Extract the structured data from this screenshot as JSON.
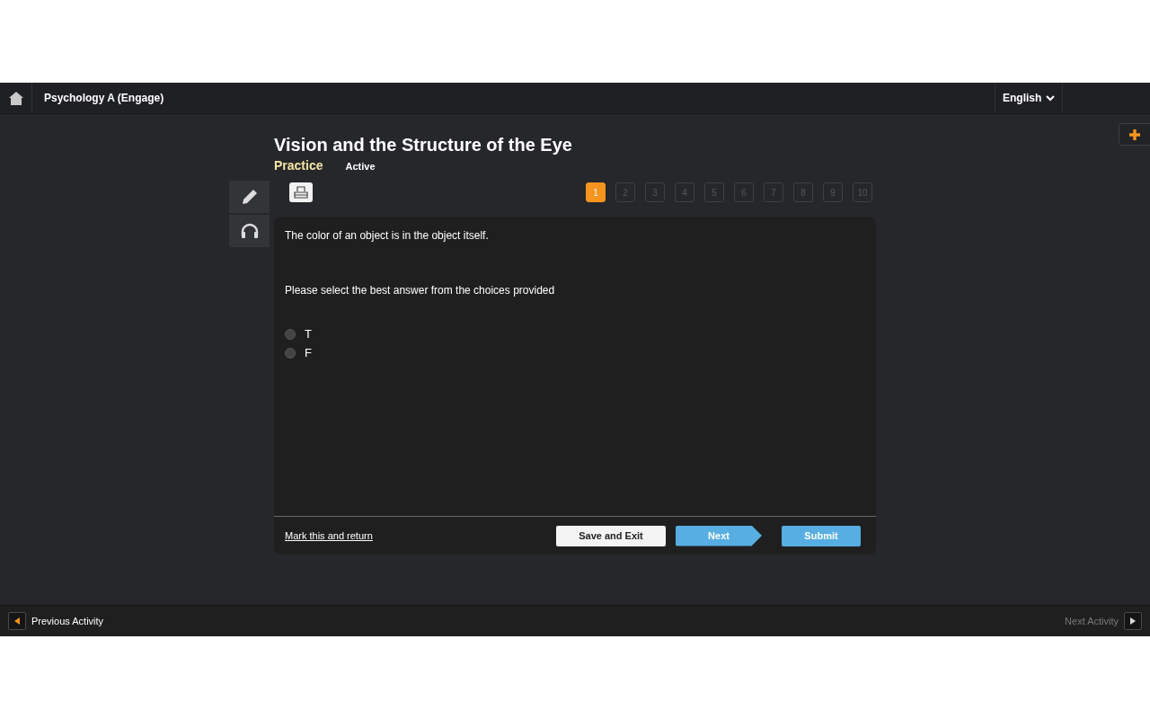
{
  "header": {
    "course": "Psychology A (Engage)",
    "language": "English"
  },
  "activity": {
    "title": "Vision and the Structure of the Eye",
    "type": "Practice",
    "status": "Active"
  },
  "pager": [
    {
      "label": "1",
      "selected": true
    },
    {
      "label": "2",
      "selected": false
    },
    {
      "label": "3",
      "selected": false
    },
    {
      "label": "4",
      "selected": false
    },
    {
      "label": "5",
      "selected": false
    },
    {
      "label": "6",
      "selected": false
    },
    {
      "label": "7",
      "selected": false
    },
    {
      "label": "8",
      "selected": false
    },
    {
      "label": "9",
      "selected": false
    },
    {
      "label": "10",
      "selected": false
    }
  ],
  "question": {
    "text": "The color of an object is in the object itself.",
    "instruction": "Please select the best answer from the choices provided",
    "choices": [
      {
        "label": "T",
        "selected": false
      },
      {
        "label": "F",
        "selected": false
      }
    ]
  },
  "footer": {
    "mark_link": "Mark this and return",
    "buttons": [
      {
        "label": "Save and Exit",
        "kind": "plain"
      },
      {
        "label": "Next",
        "kind": "arrow"
      },
      {
        "label": "Submit",
        "kind": "primary"
      }
    ]
  },
  "bottom_nav": {
    "previous": {
      "label": "Previous Activity",
      "disabled": false
    },
    "next": {
      "label": "Next Activity",
      "disabled": true
    }
  }
}
